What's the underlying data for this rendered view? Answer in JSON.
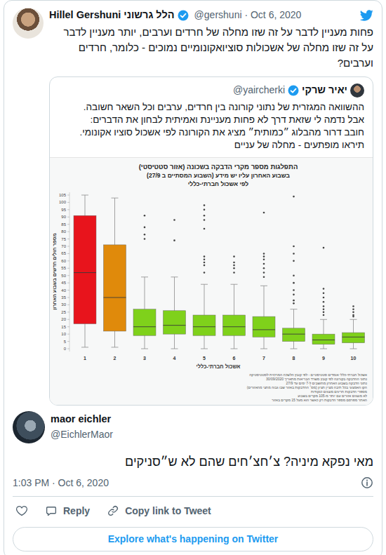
{
  "tweet": {
    "name": "Hillel Gershuni הלל גרשוני",
    "verified": true,
    "meta": "@gershuni · Oct 6, 2020",
    "text": "פחות מעניין לדבר על זה שזו מחלה של חרדים וערבים, יותר מעניין לדבר על זה שזו מחלה של אשכולות סוציואקונומיים נמוכים - כלומר, חרדים וערבים?"
  },
  "quoted": {
    "name": "יאיר שרקי",
    "verified": true,
    "handle": "@yaircherki",
    "lines": [
      "ההשוואה המגזרית של נתוני קורונה בין חרדים, ערבים וכל השאר חשובה.",
      "אבל נדמה לי שזאת דרך לא פחות מעניינת ואמיתית לבחון את הדברים:",
      "חובב דרור מהבלוג ״כמותית״ מציג את הקורונה לפי אשכול סוציו אקונומי.",
      "תיראו מופתעים - מחלה של עניים"
    ],
    "chart": {
      "title": [
        "התפלגות מספר מקרי הדבקה בשכונה (אזור סטטיסטי)",
        "בשבוע האחרון עליו יש מידע (השבוע המסתיים ב 27/9)",
        "לפי אשכול חברתי-כללי"
      ],
      "y_label": "מספר חולים חדשים בשבוע האחרון",
      "x_label": "אשכול חברתי-כללי",
      "y_ticks": [
        "0",
        "5",
        "10",
        "15",
        "20",
        "25",
        "30",
        "35",
        "40",
        "45",
        "50",
        "55",
        "60",
        "65",
        "70",
        "75",
        "80",
        "85",
        "90",
        "95",
        "100",
        "105"
      ],
      "x_ticks": [
        "1",
        "2",
        "3",
        "4",
        "5",
        "6",
        "7",
        "8",
        "9",
        "10"
      ],
      "boxes": [
        {
          "min": 1,
          "q1": 17,
          "median": 52,
          "q3": 91,
          "max": 105,
          "outliers": [],
          "color": "#e8141c"
        },
        {
          "min": 1,
          "q1": 12,
          "median": 35,
          "q3": 71,
          "max": 103,
          "outliers": [],
          "color": "#e08a0b"
        },
        {
          "min": 0,
          "q1": 9,
          "median": 15,
          "q3": 27,
          "max": 49,
          "outliers": [
            91,
            83,
            78,
            75
          ],
          "color": "#7fd11b"
        },
        {
          "min": 0,
          "q1": 10,
          "median": 16,
          "q3": 26,
          "max": 49,
          "outliers": [
            88,
            74
          ],
          "color": "#7fd11b"
        },
        {
          "min": 0,
          "q1": 9,
          "median": 15,
          "q3": 23,
          "max": 44,
          "outliers": [
            98,
            95,
            91,
            88,
            82,
            63,
            61,
            59,
            57,
            52
          ],
          "color": "#7fd11b"
        },
        {
          "min": 0,
          "q1": 9,
          "median": 15,
          "q3": 23,
          "max": 44,
          "outliers": [
            63,
            59,
            57,
            55,
            52
          ],
          "color": "#7fd11b"
        },
        {
          "min": 0,
          "q1": 8,
          "median": 13,
          "q3": 22,
          "max": 43,
          "outliers": [
            93,
            65,
            63,
            61,
            58,
            55,
            52,
            49
          ],
          "color": "#7fd11b"
        },
        {
          "min": 0,
          "q1": 5,
          "median": 10,
          "q3": 14,
          "max": 27,
          "outliers": [
            104,
            70,
            65,
            60,
            50,
            45,
            40,
            37,
            33,
            31
          ],
          "color": "#7fd11b"
        },
        {
          "min": 0,
          "q1": 3,
          "median": 6,
          "q3": 10,
          "max": 20,
          "outliers": [
            69,
            41,
            38,
            35,
            32,
            29,
            27,
            25,
            23
          ],
          "color": "#7fd11b"
        },
        {
          "min": 0,
          "q1": 4,
          "median": 8,
          "q3": 11,
          "max": 20,
          "outliers": [
            29,
            27,
            25,
            23,
            22
          ],
          "color": "#7fd11b"
        }
      ],
      "notes": [
        "אשכול חברתי-כללי אומדים סטטיסטיים - לפי קובץ הלשכה המרכזית לסטטיסטיקה",
        "נתוני ההדבקה בקורונה לפי קובץ משרד הבריאות מתאריך 30/09/2020",
        "נתוני הדבקה בשבוע האחרון מחושבים ל-7 ימים עד 27/9",
        "הקו האמצעי בכל תיבה מציין חציון (מס׳ ההדבקות באזור שבו גבוה מחצי מהאזורים)",
        "מספרי הדבקות חריגים מוצגים כנקודות",
        "לא מוצגים אזורים עם יותר מ-105 מקרים בשבוע",
        "האתר מפרסם מספר הדבקות רק כאשר הוא מעל 15 מקרים באזור"
      ]
    }
  },
  "reply": {
    "name": "maor eichler",
    "handle": "@EichlerMaor",
    "text": "מאי נפקא מיניה? צ׳חצ׳חים שהם לא ש״סניקים",
    "time": "1:03 PM · Oct 6, 2020"
  },
  "actions": [
    {
      "label": "",
      "kind": "like"
    },
    {
      "label": "Reply",
      "kind": "reply"
    },
    {
      "label": "Copy link to Tweet",
      "kind": "link"
    }
  ],
  "explore": "Explore what's happening on Twitter"
}
